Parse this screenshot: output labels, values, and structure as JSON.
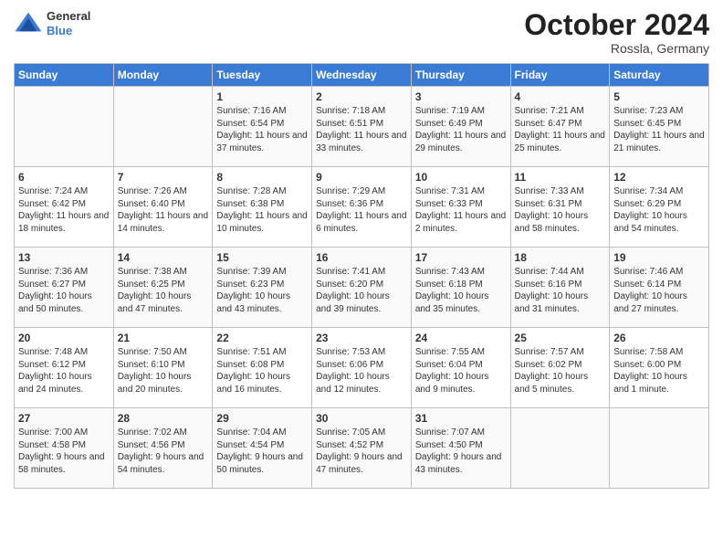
{
  "header": {
    "logo_line1": "General",
    "logo_line2": "Blue",
    "month_year": "October 2024",
    "location": "Rossla, Germany"
  },
  "days_of_week": [
    "Sunday",
    "Monday",
    "Tuesday",
    "Wednesday",
    "Thursday",
    "Friday",
    "Saturday"
  ],
  "weeks": [
    [
      {
        "day": "",
        "content": ""
      },
      {
        "day": "",
        "content": ""
      },
      {
        "day": "1",
        "content": "Sunrise: 7:16 AM\nSunset: 6:54 PM\nDaylight: 11 hours\nand 37 minutes."
      },
      {
        "day": "2",
        "content": "Sunrise: 7:18 AM\nSunset: 6:51 PM\nDaylight: 11 hours\nand 33 minutes."
      },
      {
        "day": "3",
        "content": "Sunrise: 7:19 AM\nSunset: 6:49 PM\nDaylight: 11 hours\nand 29 minutes."
      },
      {
        "day": "4",
        "content": "Sunrise: 7:21 AM\nSunset: 6:47 PM\nDaylight: 11 hours\nand 25 minutes."
      },
      {
        "day": "5",
        "content": "Sunrise: 7:23 AM\nSunset: 6:45 PM\nDaylight: 11 hours\nand 21 minutes."
      }
    ],
    [
      {
        "day": "6",
        "content": "Sunrise: 7:24 AM\nSunset: 6:42 PM\nDaylight: 11 hours\nand 18 minutes."
      },
      {
        "day": "7",
        "content": "Sunrise: 7:26 AM\nSunset: 6:40 PM\nDaylight: 11 hours\nand 14 minutes."
      },
      {
        "day": "8",
        "content": "Sunrise: 7:28 AM\nSunset: 6:38 PM\nDaylight: 11 hours\nand 10 minutes."
      },
      {
        "day": "9",
        "content": "Sunrise: 7:29 AM\nSunset: 6:36 PM\nDaylight: 11 hours\nand 6 minutes."
      },
      {
        "day": "10",
        "content": "Sunrise: 7:31 AM\nSunset: 6:33 PM\nDaylight: 11 hours\nand 2 minutes."
      },
      {
        "day": "11",
        "content": "Sunrise: 7:33 AM\nSunset: 6:31 PM\nDaylight: 10 hours\nand 58 minutes."
      },
      {
        "day": "12",
        "content": "Sunrise: 7:34 AM\nSunset: 6:29 PM\nDaylight: 10 hours\nand 54 minutes."
      }
    ],
    [
      {
        "day": "13",
        "content": "Sunrise: 7:36 AM\nSunset: 6:27 PM\nDaylight: 10 hours\nand 50 minutes."
      },
      {
        "day": "14",
        "content": "Sunrise: 7:38 AM\nSunset: 6:25 PM\nDaylight: 10 hours\nand 47 minutes."
      },
      {
        "day": "15",
        "content": "Sunrise: 7:39 AM\nSunset: 6:23 PM\nDaylight: 10 hours\nand 43 minutes."
      },
      {
        "day": "16",
        "content": "Sunrise: 7:41 AM\nSunset: 6:20 PM\nDaylight: 10 hours\nand 39 minutes."
      },
      {
        "day": "17",
        "content": "Sunrise: 7:43 AM\nSunset: 6:18 PM\nDaylight: 10 hours\nand 35 minutes."
      },
      {
        "day": "18",
        "content": "Sunrise: 7:44 AM\nSunset: 6:16 PM\nDaylight: 10 hours\nand 31 minutes."
      },
      {
        "day": "19",
        "content": "Sunrise: 7:46 AM\nSunset: 6:14 PM\nDaylight: 10 hours\nand 27 minutes."
      }
    ],
    [
      {
        "day": "20",
        "content": "Sunrise: 7:48 AM\nSunset: 6:12 PM\nDaylight: 10 hours\nand 24 minutes."
      },
      {
        "day": "21",
        "content": "Sunrise: 7:50 AM\nSunset: 6:10 PM\nDaylight: 10 hours\nand 20 minutes."
      },
      {
        "day": "22",
        "content": "Sunrise: 7:51 AM\nSunset: 6:08 PM\nDaylight: 10 hours\nand 16 minutes."
      },
      {
        "day": "23",
        "content": "Sunrise: 7:53 AM\nSunset: 6:06 PM\nDaylight: 10 hours\nand 12 minutes."
      },
      {
        "day": "24",
        "content": "Sunrise: 7:55 AM\nSunset: 6:04 PM\nDaylight: 10 hours\nand 9 minutes."
      },
      {
        "day": "25",
        "content": "Sunrise: 7:57 AM\nSunset: 6:02 PM\nDaylight: 10 hours\nand 5 minutes."
      },
      {
        "day": "26",
        "content": "Sunrise: 7:58 AM\nSunset: 6:00 PM\nDaylight: 10 hours\nand 1 minute."
      }
    ],
    [
      {
        "day": "27",
        "content": "Sunrise: 7:00 AM\nSunset: 4:58 PM\nDaylight: 9 hours\nand 58 minutes."
      },
      {
        "day": "28",
        "content": "Sunrise: 7:02 AM\nSunset: 4:56 PM\nDaylight: 9 hours\nand 54 minutes."
      },
      {
        "day": "29",
        "content": "Sunrise: 7:04 AM\nSunset: 4:54 PM\nDaylight: 9 hours\nand 50 minutes."
      },
      {
        "day": "30",
        "content": "Sunrise: 7:05 AM\nSunset: 4:52 PM\nDaylight: 9 hours\nand 47 minutes."
      },
      {
        "day": "31",
        "content": "Sunrise: 7:07 AM\nSunset: 4:50 PM\nDaylight: 9 hours\nand 43 minutes."
      },
      {
        "day": "",
        "content": ""
      },
      {
        "day": "",
        "content": ""
      }
    ]
  ]
}
